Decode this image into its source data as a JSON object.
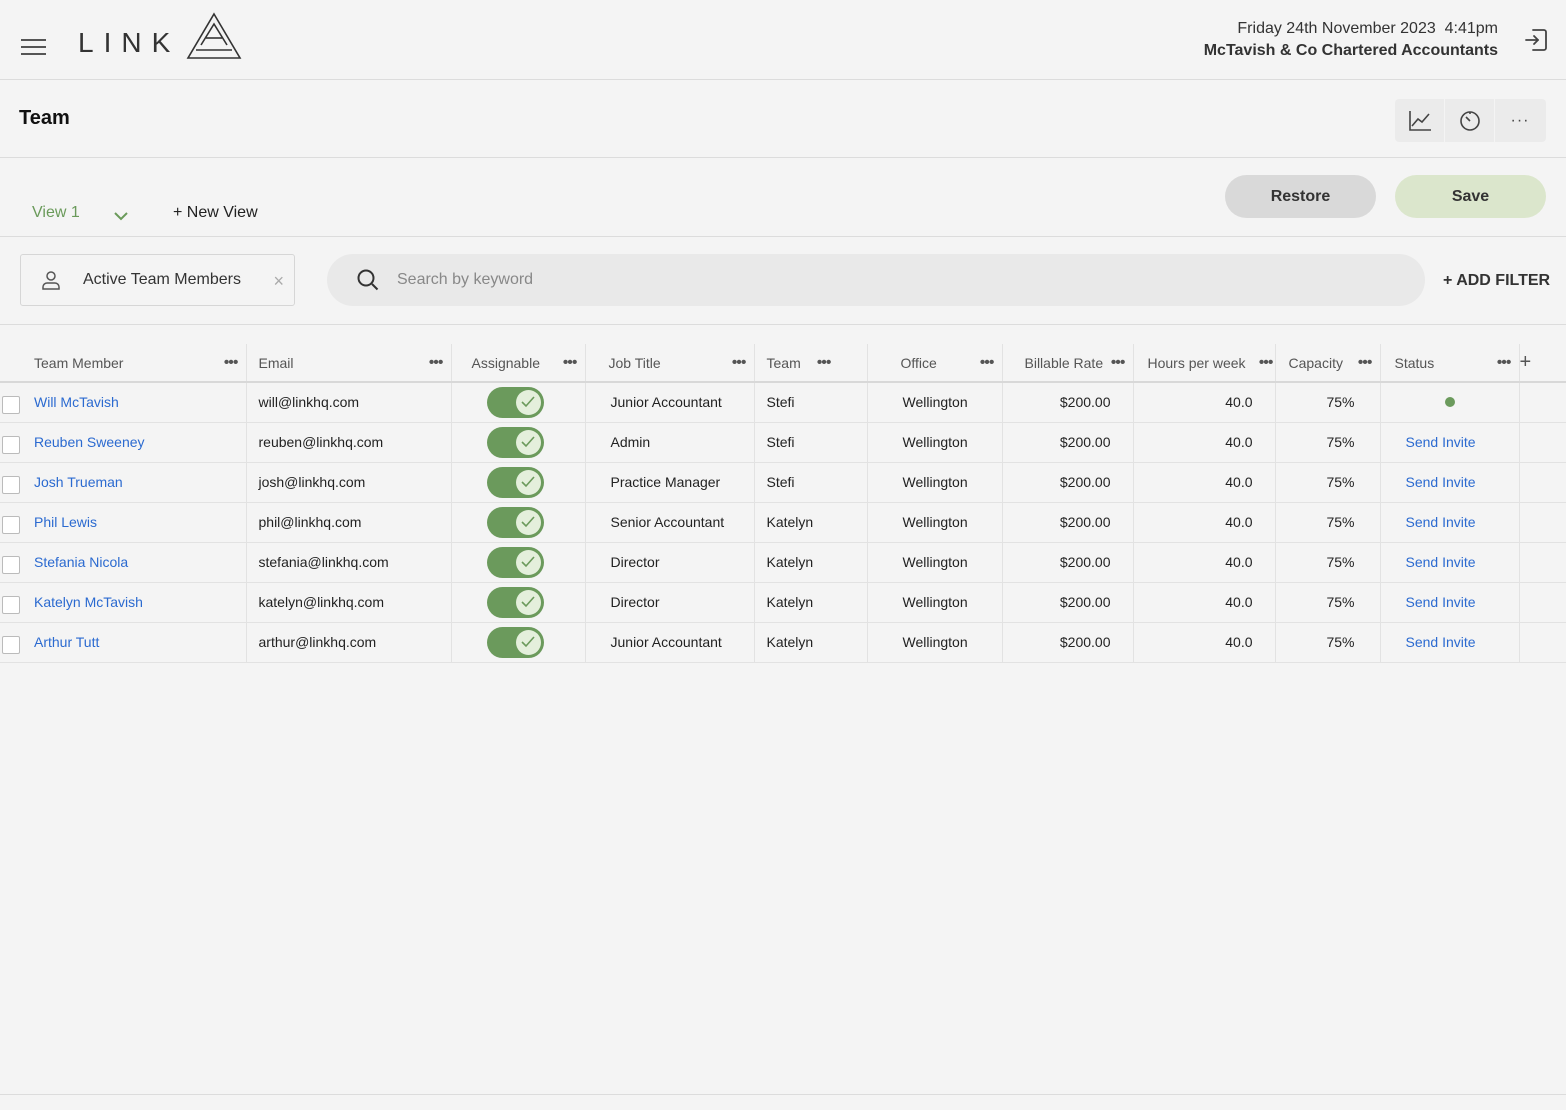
{
  "header": {
    "brand": "LINK",
    "datetime": "Friday 24th November 2023  4:41pm",
    "firm": "McTavish & Co Chartered Accountants"
  },
  "page": {
    "title": "Team"
  },
  "views": {
    "current": "View 1",
    "new_view_label": "+ New View",
    "restore_label": "Restore",
    "save_label": "Save"
  },
  "filters": {
    "chip_label": "Active Team Members",
    "chip_close": "×",
    "search_placeholder": "Search by keyword",
    "add_filter_label": "+ ADD FILTER"
  },
  "table": {
    "columns": [
      "Team Member",
      "Email",
      "Assignable",
      "Job Title",
      "Team",
      "Office",
      "Billable Rate",
      "Hours per week",
      "Capacity",
      "Status"
    ],
    "add_column_label": "+",
    "rows": [
      {
        "name": "Will McTavish",
        "email": "will@linkhq.com",
        "assignable": true,
        "job": "Junior Accountant",
        "team": "Stefi",
        "office": "Wellington",
        "rate": "$200.00",
        "hours": "40.0",
        "capacity": "75%",
        "status": "active"
      },
      {
        "name": "Reuben Sweeney",
        "email": "reuben@linkhq.com",
        "assignable": true,
        "job": "Admin",
        "team": "Stefi",
        "office": "Wellington",
        "rate": "$200.00",
        "hours": "40.0",
        "capacity": "75%",
        "status": "Send Invite"
      },
      {
        "name": "Josh Trueman",
        "email": "josh@linkhq.com",
        "assignable": true,
        "job": "Practice Manager",
        "team": "Stefi",
        "office": "Wellington",
        "rate": "$200.00",
        "hours": "40.0",
        "capacity": "75%",
        "status": "Send Invite"
      },
      {
        "name": "Phil Lewis",
        "email": "phil@linkhq.com",
        "assignable": true,
        "job": "Senior Accountant",
        "team": "Katelyn",
        "office": "Wellington",
        "rate": "$200.00",
        "hours": "40.0",
        "capacity": "75%",
        "status": "Send Invite"
      },
      {
        "name": "Stefania Nicola",
        "email": "stefania@linkhq.com",
        "assignable": true,
        "job": "Director",
        "team": "Katelyn",
        "office": "Wellington",
        "rate": "$200.00",
        "hours": "40.0",
        "capacity": "75%",
        "status": "Send Invite"
      },
      {
        "name": "Katelyn McTavish",
        "email": "katelyn@linkhq.com",
        "assignable": true,
        "job": "Director",
        "team": "Katelyn",
        "office": "Wellington",
        "rate": "$200.00",
        "hours": "40.0",
        "capacity": "75%",
        "status": "Send Invite"
      },
      {
        "name": "Arthur Tutt",
        "email": "arthur@linkhq.com",
        "assignable": true,
        "job": "Junior Accountant",
        "team": "Katelyn",
        "office": "Wellington",
        "rate": "$200.00",
        "hours": "40.0",
        "capacity": "75%",
        "status": "Send Invite"
      }
    ]
  },
  "colors": {
    "accent": "#6b9a5c",
    "link": "#2b6ad0",
    "save_bg": "#dbe6cc"
  },
  "icons": [
    "hamburger-icon",
    "logout-icon",
    "chart-icon",
    "timer-icon",
    "more-icon",
    "chevron-down-icon",
    "user-icon",
    "close-icon",
    "search-icon",
    "check-icon"
  ]
}
